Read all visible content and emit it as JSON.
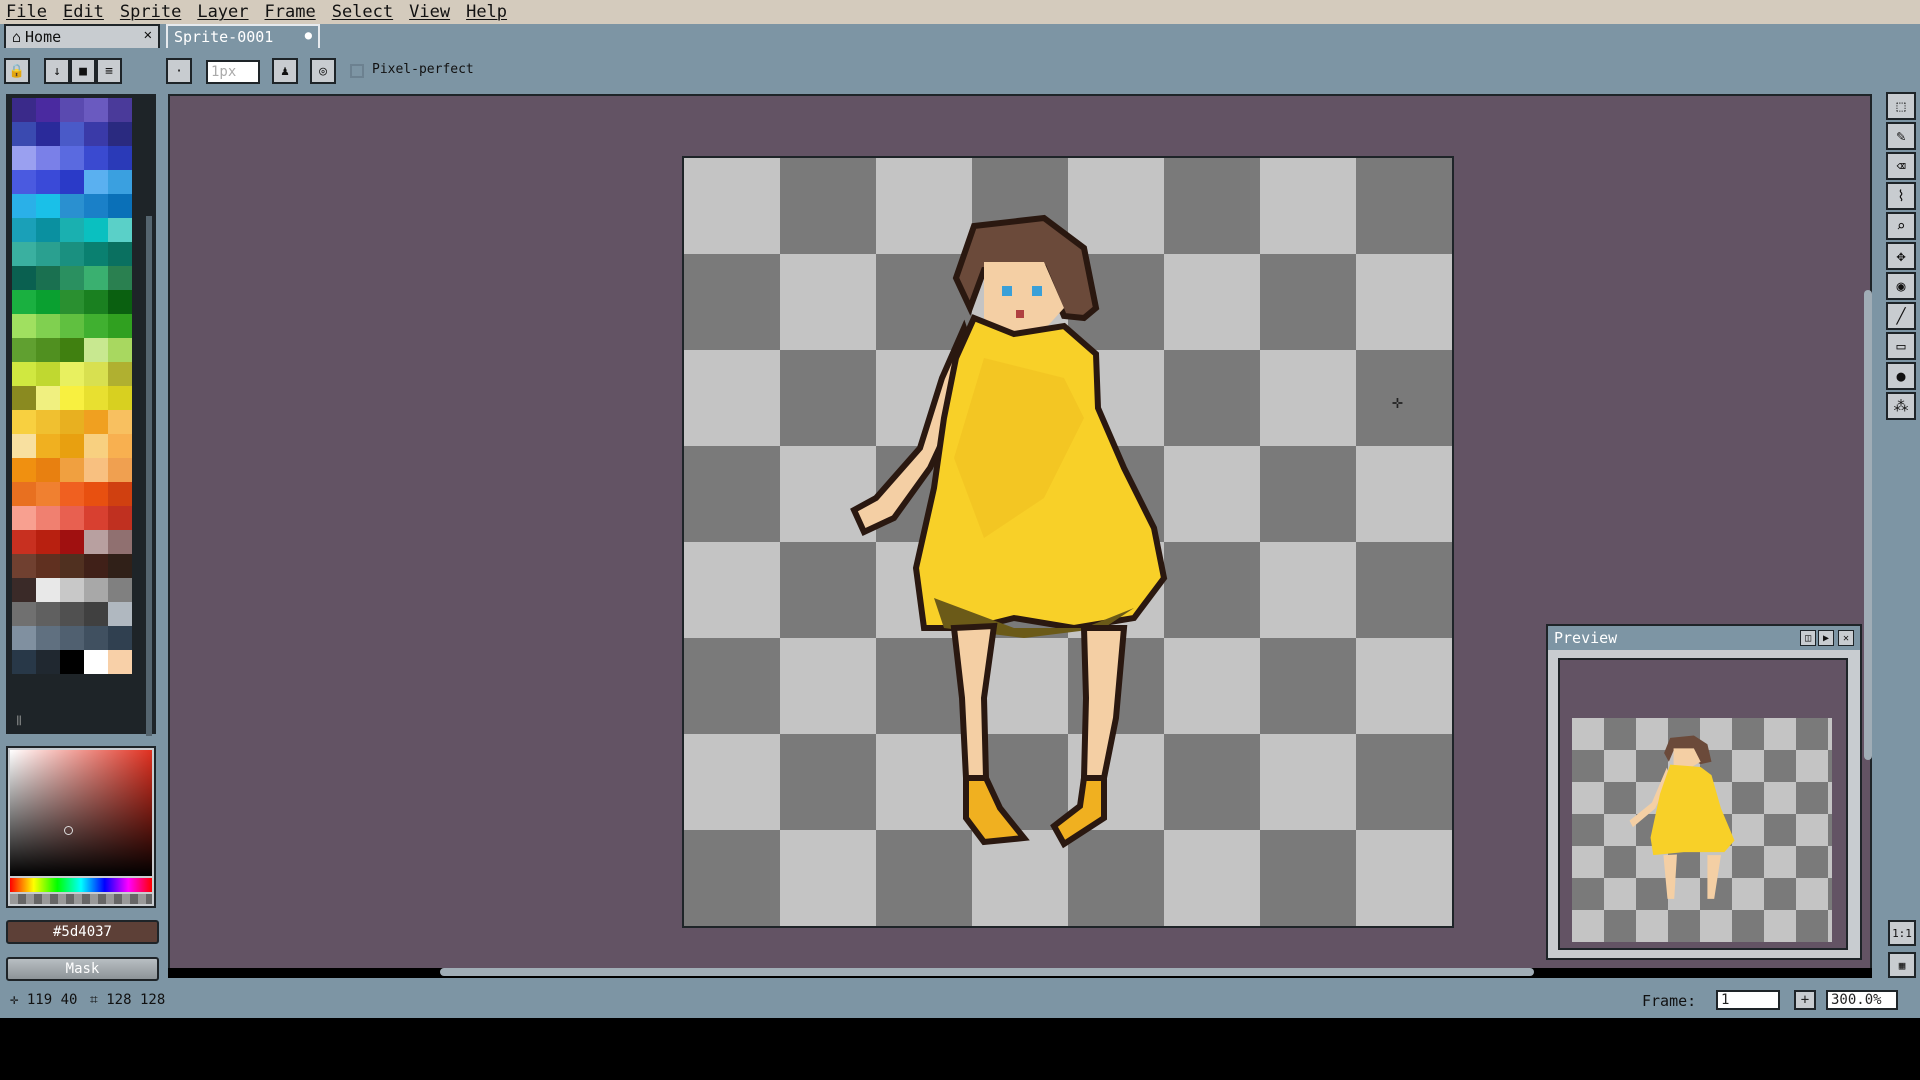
{
  "menu": [
    "File",
    "Edit",
    "Sprite",
    "Layer",
    "Frame",
    "Select",
    "View",
    "Help"
  ],
  "tabs": {
    "home": "Home",
    "sprite": "Sprite-0001"
  },
  "toolbar": {
    "brush_size_placeholder": "1px",
    "pixel_perfect_label": "Pixel-perfect",
    "layer_buttons": [
      "lock-icon",
      "arrow-down-icon",
      "square-icon",
      "menu-icon"
    ]
  },
  "palette_colors": [
    "#3a2a8a",
    "#4a2aa0",
    "#5a4ab0",
    "#6a5ac0",
    "#4a3a9a",
    "#3a4ab0",
    "#2a2a9a",
    "#4a5ac8",
    "#3a3aa8",
    "#2a2a80",
    "#9aa0f0",
    "#7a80e8",
    "#5a6ae0",
    "#3a4ad0",
    "#2a3ab8",
    "#4a5ae0",
    "#3a4ad8",
    "#2a3ac8",
    "#5ab0f0",
    "#3aa0e0",
    "#2ab0e8",
    "#1ac0e8",
    "#2a90d0",
    "#1a80c8",
    "#0a70b8",
    "#1aa0b8",
    "#0a90a0",
    "#1ab0b0",
    "#0ac0c0",
    "#5ad0c8",
    "#3ab0a0",
    "#2aa090",
    "#1a9080",
    "#0a8070",
    "#0a7060",
    "#0a6050",
    "#1a7050",
    "#2a9060",
    "#3ab070",
    "#2a8050",
    "#1ab040",
    "#0aa030",
    "#2a9030",
    "#1a8020",
    "#0a6010",
    "#a0e060",
    "#80d050",
    "#60c040",
    "#40b030",
    "#30a020",
    "#60a030",
    "#509020",
    "#408010",
    "#c8e890",
    "#a8d860",
    "#d0e840",
    "#c0d830",
    "#e8f060",
    "#d8e050",
    "#b0b030",
    "#8a8a20",
    "#f0f080",
    "#f8f040",
    "#e8e030",
    "#d8d020",
    "#f8d040",
    "#f0c030",
    "#e8b020",
    "#f0a020",
    "#f8c060",
    "#f8e0a0",
    "#f0b020",
    "#e8a010",
    "#f8d080",
    "#f8b050",
    "#f09010",
    "#e88010",
    "#f0a040",
    "#f8c080",
    "#f0a050",
    "#e87020",
    "#f08030",
    "#f06020",
    "#e85010",
    "#d04010",
    "#f8a090",
    "#f08070",
    "#e86050",
    "#d84030",
    "#c03020",
    "#c83020",
    "#b82010",
    "#a01010",
    "#b8a0a0",
    "#907070",
    "#704030",
    "#603020",
    "#503020",
    "#402018",
    "#302018",
    "#3a2a28",
    "#e8e8e8",
    "#c8c8c8",
    "#a8a8a8",
    "#808080",
    "#707070",
    "#606060",
    "#505050",
    "#404040",
    "#b0b8c0",
    "#8090a0",
    "#607080",
    "#506070",
    "#405060",
    "#304050",
    "#283848",
    "#202830",
    "#000000",
    "#ffffff",
    "#f8d0a8"
  ],
  "color_picker": {
    "hex": "#5d4037"
  },
  "mask_label": "Mask",
  "preview": {
    "title": "Preview"
  },
  "status": {
    "cursor_x": "119",
    "cursor_y": "40",
    "size_w": "128",
    "size_h": "128",
    "frame_label": "Frame:",
    "frame_value": "1",
    "zoom_value": "300.0%"
  },
  "tools": [
    "marquee-icon",
    "pencil-icon",
    "eraser-icon",
    "eyedropper-icon",
    "zoom-icon",
    "move-icon",
    "fill-icon",
    "line-icon",
    "rectangle-icon",
    "blob-icon",
    "spray-icon"
  ],
  "side_buttons": {
    "one_to_one": "1:1"
  }
}
